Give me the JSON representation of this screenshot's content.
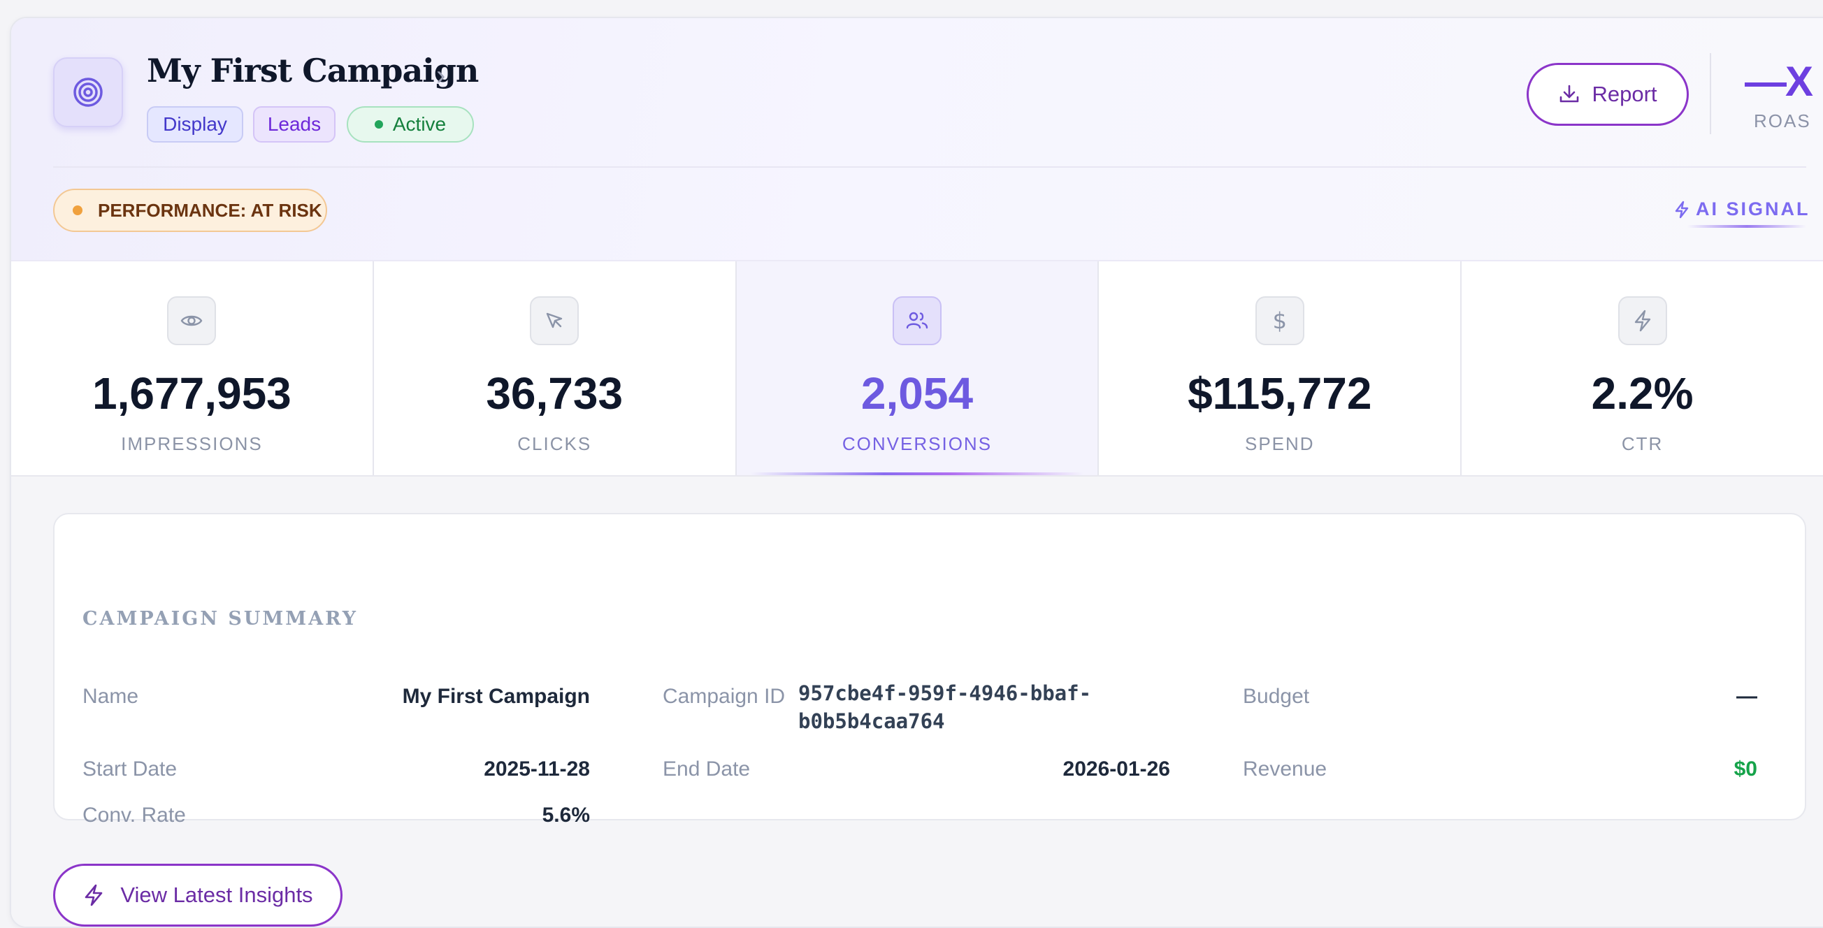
{
  "campaign": {
    "title": "My First Campaign",
    "tags": [
      "Display",
      "Leads",
      "Active"
    ]
  },
  "header": {
    "report_label": "Report",
    "roas_value": "—X",
    "roas_label": "ROAS",
    "performance_label": "PERFORMANCE: AT RISK",
    "ai_signal_label": "AI SIGNAL"
  },
  "stats": [
    {
      "value": "1,677,953",
      "label": "IMPRESSIONS",
      "icon": "eye-icon"
    },
    {
      "value": "36,733",
      "label": "CLICKS",
      "icon": "cursor-icon"
    },
    {
      "value": "2,054",
      "label": "CONVERSIONS",
      "icon": "users-icon"
    },
    {
      "value": "$115,772",
      "label": "SPEND",
      "icon": "dollar-icon"
    },
    {
      "value": "2.2%",
      "label": "CTR",
      "icon": "lightning-icon"
    }
  ],
  "summary": {
    "title": "CAMPAIGN SUMMARY",
    "name_label": "Name",
    "name_value": "My First Campaign",
    "id_label": "Campaign ID",
    "id_value_line1": "957cbe4f-959f-4946-bbaf-",
    "id_value_line2": "b0b5b4caa764",
    "budget_label": "Budget",
    "budget_value": "—",
    "start_label": "Start Date",
    "start_value": "2025-11-28",
    "end_label": "End Date",
    "end_value": "2026-01-26",
    "revenue_label": "Revenue",
    "revenue_value": "$0",
    "conv_label": "Conv. Rate",
    "conv_value": "5.6%"
  },
  "insights_button": "View Latest Insights",
  "colors": {
    "accent": "#6d5ae0",
    "button_border": "#8b35c9",
    "active_green": "#22a55b",
    "risk_orange": "#f0a13e",
    "revenue_green": "#16a34a"
  }
}
